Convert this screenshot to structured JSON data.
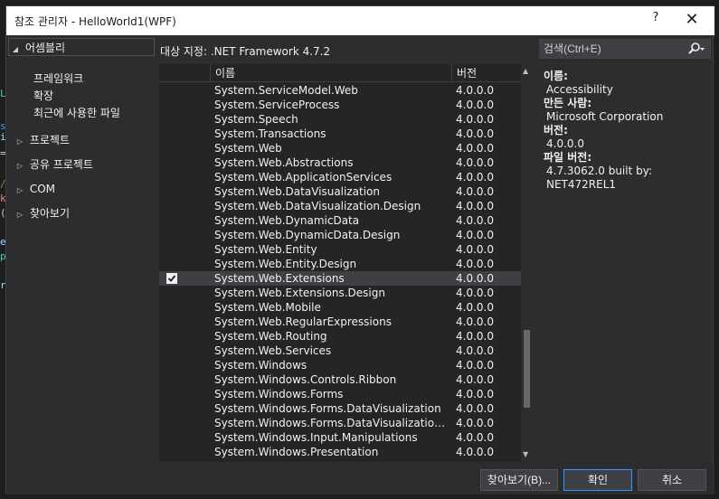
{
  "dialog": {
    "title": "참조 관리자 - HelloWorld1(WPF)",
    "help_label": "?",
    "close_label": "✕"
  },
  "nav": {
    "assemblies": "어셈블리",
    "framework": "프레임워크",
    "extensions": "확장",
    "recent": "최근에 사용한 파일",
    "projects": "프로젝트",
    "shared_projects": "공유 프로젝트",
    "com": "COM",
    "browse": "찾아보기"
  },
  "header": {
    "target": "대상 지정: .NET Framework 4.7.2",
    "search_placeholder": "검색(Ctrl+E)"
  },
  "list": {
    "col_name": "이름",
    "col_version": "버전",
    "rows": [
      {
        "name": "System.ServiceModel.Web",
        "version": "4.0.0.0",
        "checked": false
      },
      {
        "name": "System.ServiceProcess",
        "version": "4.0.0.0",
        "checked": false
      },
      {
        "name": "System.Speech",
        "version": "4.0.0.0",
        "checked": false
      },
      {
        "name": "System.Transactions",
        "version": "4.0.0.0",
        "checked": false
      },
      {
        "name": "System.Web",
        "version": "4.0.0.0",
        "checked": false
      },
      {
        "name": "System.Web.Abstractions",
        "version": "4.0.0.0",
        "checked": false
      },
      {
        "name": "System.Web.ApplicationServices",
        "version": "4.0.0.0",
        "checked": false
      },
      {
        "name": "System.Web.DataVisualization",
        "version": "4.0.0.0",
        "checked": false
      },
      {
        "name": "System.Web.DataVisualization.Design",
        "version": "4.0.0.0",
        "checked": false
      },
      {
        "name": "System.Web.DynamicData",
        "version": "4.0.0.0",
        "checked": false
      },
      {
        "name": "System.Web.DynamicData.Design",
        "version": "4.0.0.0",
        "checked": false
      },
      {
        "name": "System.Web.Entity",
        "version": "4.0.0.0",
        "checked": false
      },
      {
        "name": "System.Web.Entity.Design",
        "version": "4.0.0.0",
        "checked": false
      },
      {
        "name": "System.Web.Extensions",
        "version": "4.0.0.0",
        "checked": true
      },
      {
        "name": "System.Web.Extensions.Design",
        "version": "4.0.0.0",
        "checked": false
      },
      {
        "name": "System.Web.Mobile",
        "version": "4.0.0.0",
        "checked": false
      },
      {
        "name": "System.Web.RegularExpressions",
        "version": "4.0.0.0",
        "checked": false
      },
      {
        "name": "System.Web.Routing",
        "version": "4.0.0.0",
        "checked": false
      },
      {
        "name": "System.Web.Services",
        "version": "4.0.0.0",
        "checked": false
      },
      {
        "name": "System.Windows",
        "version": "4.0.0.0",
        "checked": false
      },
      {
        "name": "System.Windows.Controls.Ribbon",
        "version": "4.0.0.0",
        "checked": false
      },
      {
        "name": "System.Windows.Forms",
        "version": "4.0.0.0",
        "checked": false
      },
      {
        "name": "System.Windows.Forms.DataVisualization",
        "version": "4.0.0.0",
        "checked": false
      },
      {
        "name": "System.Windows.Forms.DataVisualization.Des...",
        "version": "4.0.0.0",
        "checked": false
      },
      {
        "name": "System.Windows.Input.Manipulations",
        "version": "4.0.0.0",
        "checked": false
      },
      {
        "name": "System.Windows.Presentation",
        "version": "4.0.0.0",
        "checked": false
      }
    ]
  },
  "details": {
    "name_label": "이름:",
    "name_value": "Accessibility",
    "author_label": "만든 사람:",
    "author_value": "Microsoft Corporation",
    "version_label": "버전:",
    "version_value": "4.0.0.0",
    "file_version_label": "파일 버전:",
    "file_version_value": "4.7.3062.0 built by: NET472REL1"
  },
  "footer": {
    "browse_button": "찾아보기(B)...",
    "ok_button": "확인",
    "cancel_button": "취소"
  },
  "colors": {
    "dialog_bg": "#2d2d30",
    "list_bg": "#252526",
    "selected_row": "#3f3f46",
    "primary_border": "#3399ff"
  },
  "background": {
    "editor_glyphs": [
      "L",
      "s",
      "i",
      "=",
      "/",
      "k",
      "(",
      "e",
      "p",
      "r"
    ]
  }
}
